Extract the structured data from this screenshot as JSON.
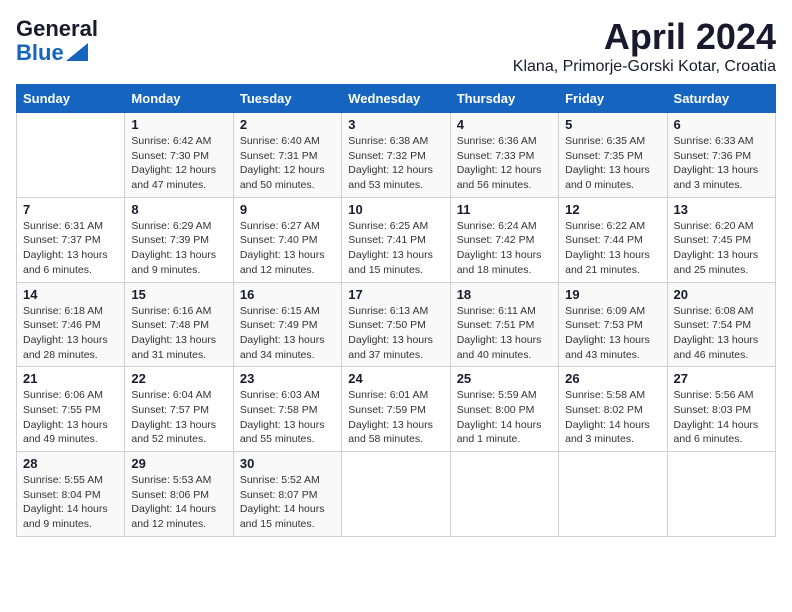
{
  "logo": {
    "line1": "General",
    "line2": "Blue"
  },
  "title": "April 2024",
  "subtitle": "Klana, Primorje-Gorski Kotar, Croatia",
  "weekdays": [
    "Sunday",
    "Monday",
    "Tuesday",
    "Wednesday",
    "Thursday",
    "Friday",
    "Saturday"
  ],
  "weeks": [
    [
      {
        "day": "",
        "info": ""
      },
      {
        "day": "1",
        "info": "Sunrise: 6:42 AM\nSunset: 7:30 PM\nDaylight: 12 hours\nand 47 minutes."
      },
      {
        "day": "2",
        "info": "Sunrise: 6:40 AM\nSunset: 7:31 PM\nDaylight: 12 hours\nand 50 minutes."
      },
      {
        "day": "3",
        "info": "Sunrise: 6:38 AM\nSunset: 7:32 PM\nDaylight: 12 hours\nand 53 minutes."
      },
      {
        "day": "4",
        "info": "Sunrise: 6:36 AM\nSunset: 7:33 PM\nDaylight: 12 hours\nand 56 minutes."
      },
      {
        "day": "5",
        "info": "Sunrise: 6:35 AM\nSunset: 7:35 PM\nDaylight: 13 hours\nand 0 minutes."
      },
      {
        "day": "6",
        "info": "Sunrise: 6:33 AM\nSunset: 7:36 PM\nDaylight: 13 hours\nand 3 minutes."
      }
    ],
    [
      {
        "day": "7",
        "info": "Sunrise: 6:31 AM\nSunset: 7:37 PM\nDaylight: 13 hours\nand 6 minutes."
      },
      {
        "day": "8",
        "info": "Sunrise: 6:29 AM\nSunset: 7:39 PM\nDaylight: 13 hours\nand 9 minutes."
      },
      {
        "day": "9",
        "info": "Sunrise: 6:27 AM\nSunset: 7:40 PM\nDaylight: 13 hours\nand 12 minutes."
      },
      {
        "day": "10",
        "info": "Sunrise: 6:25 AM\nSunset: 7:41 PM\nDaylight: 13 hours\nand 15 minutes."
      },
      {
        "day": "11",
        "info": "Sunrise: 6:24 AM\nSunset: 7:42 PM\nDaylight: 13 hours\nand 18 minutes."
      },
      {
        "day": "12",
        "info": "Sunrise: 6:22 AM\nSunset: 7:44 PM\nDaylight: 13 hours\nand 21 minutes."
      },
      {
        "day": "13",
        "info": "Sunrise: 6:20 AM\nSunset: 7:45 PM\nDaylight: 13 hours\nand 25 minutes."
      }
    ],
    [
      {
        "day": "14",
        "info": "Sunrise: 6:18 AM\nSunset: 7:46 PM\nDaylight: 13 hours\nand 28 minutes."
      },
      {
        "day": "15",
        "info": "Sunrise: 6:16 AM\nSunset: 7:48 PM\nDaylight: 13 hours\nand 31 minutes."
      },
      {
        "day": "16",
        "info": "Sunrise: 6:15 AM\nSunset: 7:49 PM\nDaylight: 13 hours\nand 34 minutes."
      },
      {
        "day": "17",
        "info": "Sunrise: 6:13 AM\nSunset: 7:50 PM\nDaylight: 13 hours\nand 37 minutes."
      },
      {
        "day": "18",
        "info": "Sunrise: 6:11 AM\nSunset: 7:51 PM\nDaylight: 13 hours\nand 40 minutes."
      },
      {
        "day": "19",
        "info": "Sunrise: 6:09 AM\nSunset: 7:53 PM\nDaylight: 13 hours\nand 43 minutes."
      },
      {
        "day": "20",
        "info": "Sunrise: 6:08 AM\nSunset: 7:54 PM\nDaylight: 13 hours\nand 46 minutes."
      }
    ],
    [
      {
        "day": "21",
        "info": "Sunrise: 6:06 AM\nSunset: 7:55 PM\nDaylight: 13 hours\nand 49 minutes."
      },
      {
        "day": "22",
        "info": "Sunrise: 6:04 AM\nSunset: 7:57 PM\nDaylight: 13 hours\nand 52 minutes."
      },
      {
        "day": "23",
        "info": "Sunrise: 6:03 AM\nSunset: 7:58 PM\nDaylight: 13 hours\nand 55 minutes."
      },
      {
        "day": "24",
        "info": "Sunrise: 6:01 AM\nSunset: 7:59 PM\nDaylight: 13 hours\nand 58 minutes."
      },
      {
        "day": "25",
        "info": "Sunrise: 5:59 AM\nSunset: 8:00 PM\nDaylight: 14 hours\nand 1 minute."
      },
      {
        "day": "26",
        "info": "Sunrise: 5:58 AM\nSunset: 8:02 PM\nDaylight: 14 hours\nand 3 minutes."
      },
      {
        "day": "27",
        "info": "Sunrise: 5:56 AM\nSunset: 8:03 PM\nDaylight: 14 hours\nand 6 minutes."
      }
    ],
    [
      {
        "day": "28",
        "info": "Sunrise: 5:55 AM\nSunset: 8:04 PM\nDaylight: 14 hours\nand 9 minutes."
      },
      {
        "day": "29",
        "info": "Sunrise: 5:53 AM\nSunset: 8:06 PM\nDaylight: 14 hours\nand 12 minutes."
      },
      {
        "day": "30",
        "info": "Sunrise: 5:52 AM\nSunset: 8:07 PM\nDaylight: 14 hours\nand 15 minutes."
      },
      {
        "day": "",
        "info": ""
      },
      {
        "day": "",
        "info": ""
      },
      {
        "day": "",
        "info": ""
      },
      {
        "day": "",
        "info": ""
      }
    ]
  ]
}
